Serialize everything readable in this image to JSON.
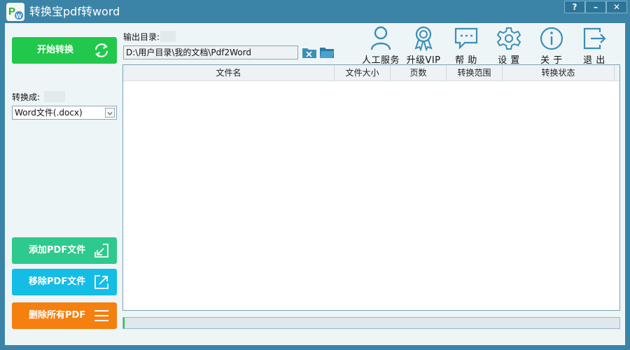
{
  "window": {
    "title": "转换宝pdf转word",
    "help_label": "?",
    "minimize_label": "–",
    "close_label": "✕"
  },
  "sidebar": {
    "start_label": "开始转换",
    "convert_to_label": "转换成:",
    "format_selected": "Word文件(.docx)",
    "add_pdf_label": "添加PDF文件",
    "remove_pdf_label": "移除PDF文件",
    "clear_all_label": "删除所有PDF"
  },
  "output": {
    "label": "输出目录:",
    "path": "D:\\用户目录\\我的文档\\Pdf2Word"
  },
  "toolbar": {
    "service": "人工服务",
    "upgrade": "升级VIP",
    "help": "帮 助",
    "settings": "设 置",
    "about": "关 于",
    "exit": "退 出"
  },
  "table": {
    "columns": [
      "文件名",
      "文件大小",
      "页数",
      "转换范围",
      "转换状态"
    ],
    "rows": []
  },
  "progress": {
    "percent": 0
  },
  "colors": {
    "titlebar": "#3b84a8",
    "start": "#22c84c",
    "add": "#2ec98d",
    "remove": "#14bde6",
    "clear": "#f57f0f",
    "icon": "#3a8fb5"
  }
}
